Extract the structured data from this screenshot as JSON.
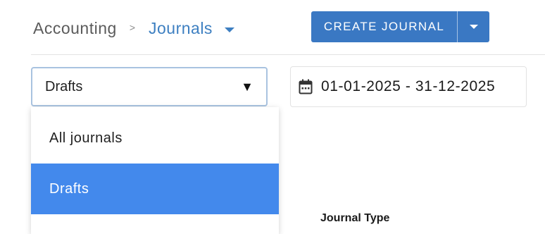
{
  "breadcrumb": {
    "root": "Accounting",
    "separator": ">",
    "current": "Journals"
  },
  "actions": {
    "create_label": "CREATE JOURNAL"
  },
  "filters": {
    "journal_filter_value": "Drafts",
    "journal_filter_arrow": "▼",
    "date_range": "01-01-2025 - 31-12-2025"
  },
  "dropdown": {
    "items": [
      {
        "label": "All journals",
        "selected": false
      },
      {
        "label": "Drafts",
        "selected": true
      }
    ]
  },
  "table": {
    "columns": [
      "Journal Type"
    ]
  },
  "colors": {
    "accent": "#3a78c3",
    "link": "#3d7fc1",
    "selected_item": "#4389ec"
  },
  "icons": {
    "date": "calendar-icon",
    "breadcrumb_dropdown": "caret-down-icon",
    "split_button": "caret-down-icon"
  }
}
